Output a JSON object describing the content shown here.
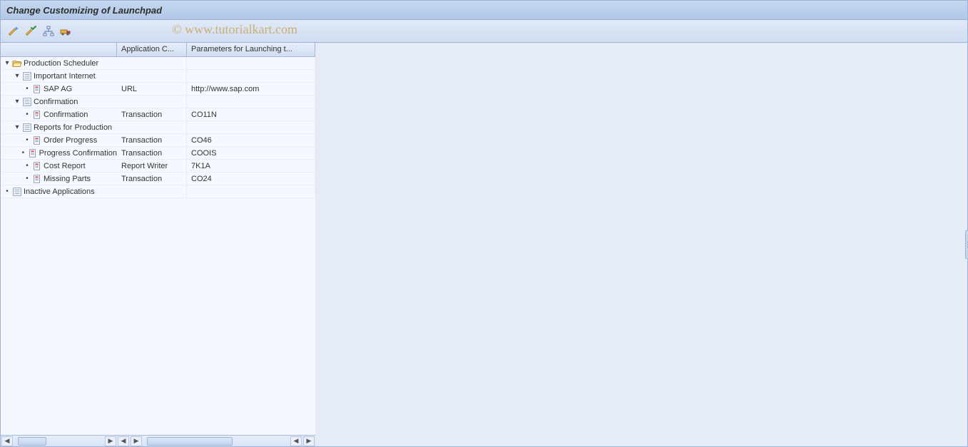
{
  "header": {
    "title": "Change Customizing of Launchpad"
  },
  "watermark": "© www.tutorialkart.com",
  "toolbar": {
    "buttons": [
      {
        "name": "wand-icon",
        "title": "Change"
      },
      {
        "name": "wand-check-icon",
        "title": "Check"
      },
      {
        "name": "hierarchy-icon",
        "title": "Hierarchy"
      },
      {
        "name": "transport-icon",
        "title": "Transport"
      }
    ]
  },
  "columns": {
    "tree": "",
    "app_category": "Application C...",
    "params": "Parameters for Launching t..."
  },
  "tree": [
    {
      "level": 0,
      "exp": "▾",
      "icon": "folder-open-icon",
      "label": "Production Scheduler",
      "app": "",
      "param": ""
    },
    {
      "level": 1,
      "exp": "▾",
      "icon": "list-icon",
      "label": "Important Internet",
      "app": "",
      "param": ""
    },
    {
      "level": 2,
      "exp": "•",
      "icon": "doc-link-icon",
      "label": "SAP AG",
      "app": "URL",
      "param": "http://www.sap.com"
    },
    {
      "level": 1,
      "exp": "▾",
      "icon": "list-icon",
      "label": "Confirmation",
      "app": "",
      "param": ""
    },
    {
      "level": 2,
      "exp": "•",
      "icon": "doc-link-icon",
      "label": "Confirmation",
      "app": "Transaction",
      "param": "CO11N"
    },
    {
      "level": 1,
      "exp": "▾",
      "icon": "list-icon",
      "label": "Reports for Production",
      "app": "",
      "param": ""
    },
    {
      "level": 2,
      "exp": "•",
      "icon": "doc-link-icon",
      "label": "Order Progress",
      "app": "Transaction",
      "param": "CO46"
    },
    {
      "level": 2,
      "exp": "•",
      "icon": "doc-link-icon",
      "label": "Progress Confirmation",
      "app": "Transaction",
      "param": "COOIS"
    },
    {
      "level": 2,
      "exp": "•",
      "icon": "doc-link-icon",
      "label": "Cost Report",
      "app": "Report Writer",
      "param": "7K1A"
    },
    {
      "level": 2,
      "exp": "•",
      "icon": "doc-link-icon",
      "label": "Missing Parts",
      "app": "Transaction",
      "param": "CO24"
    },
    {
      "level": 0,
      "exp": "•",
      "icon": "list-icon",
      "label": "Inactive Applications",
      "app": "",
      "param": ""
    }
  ]
}
